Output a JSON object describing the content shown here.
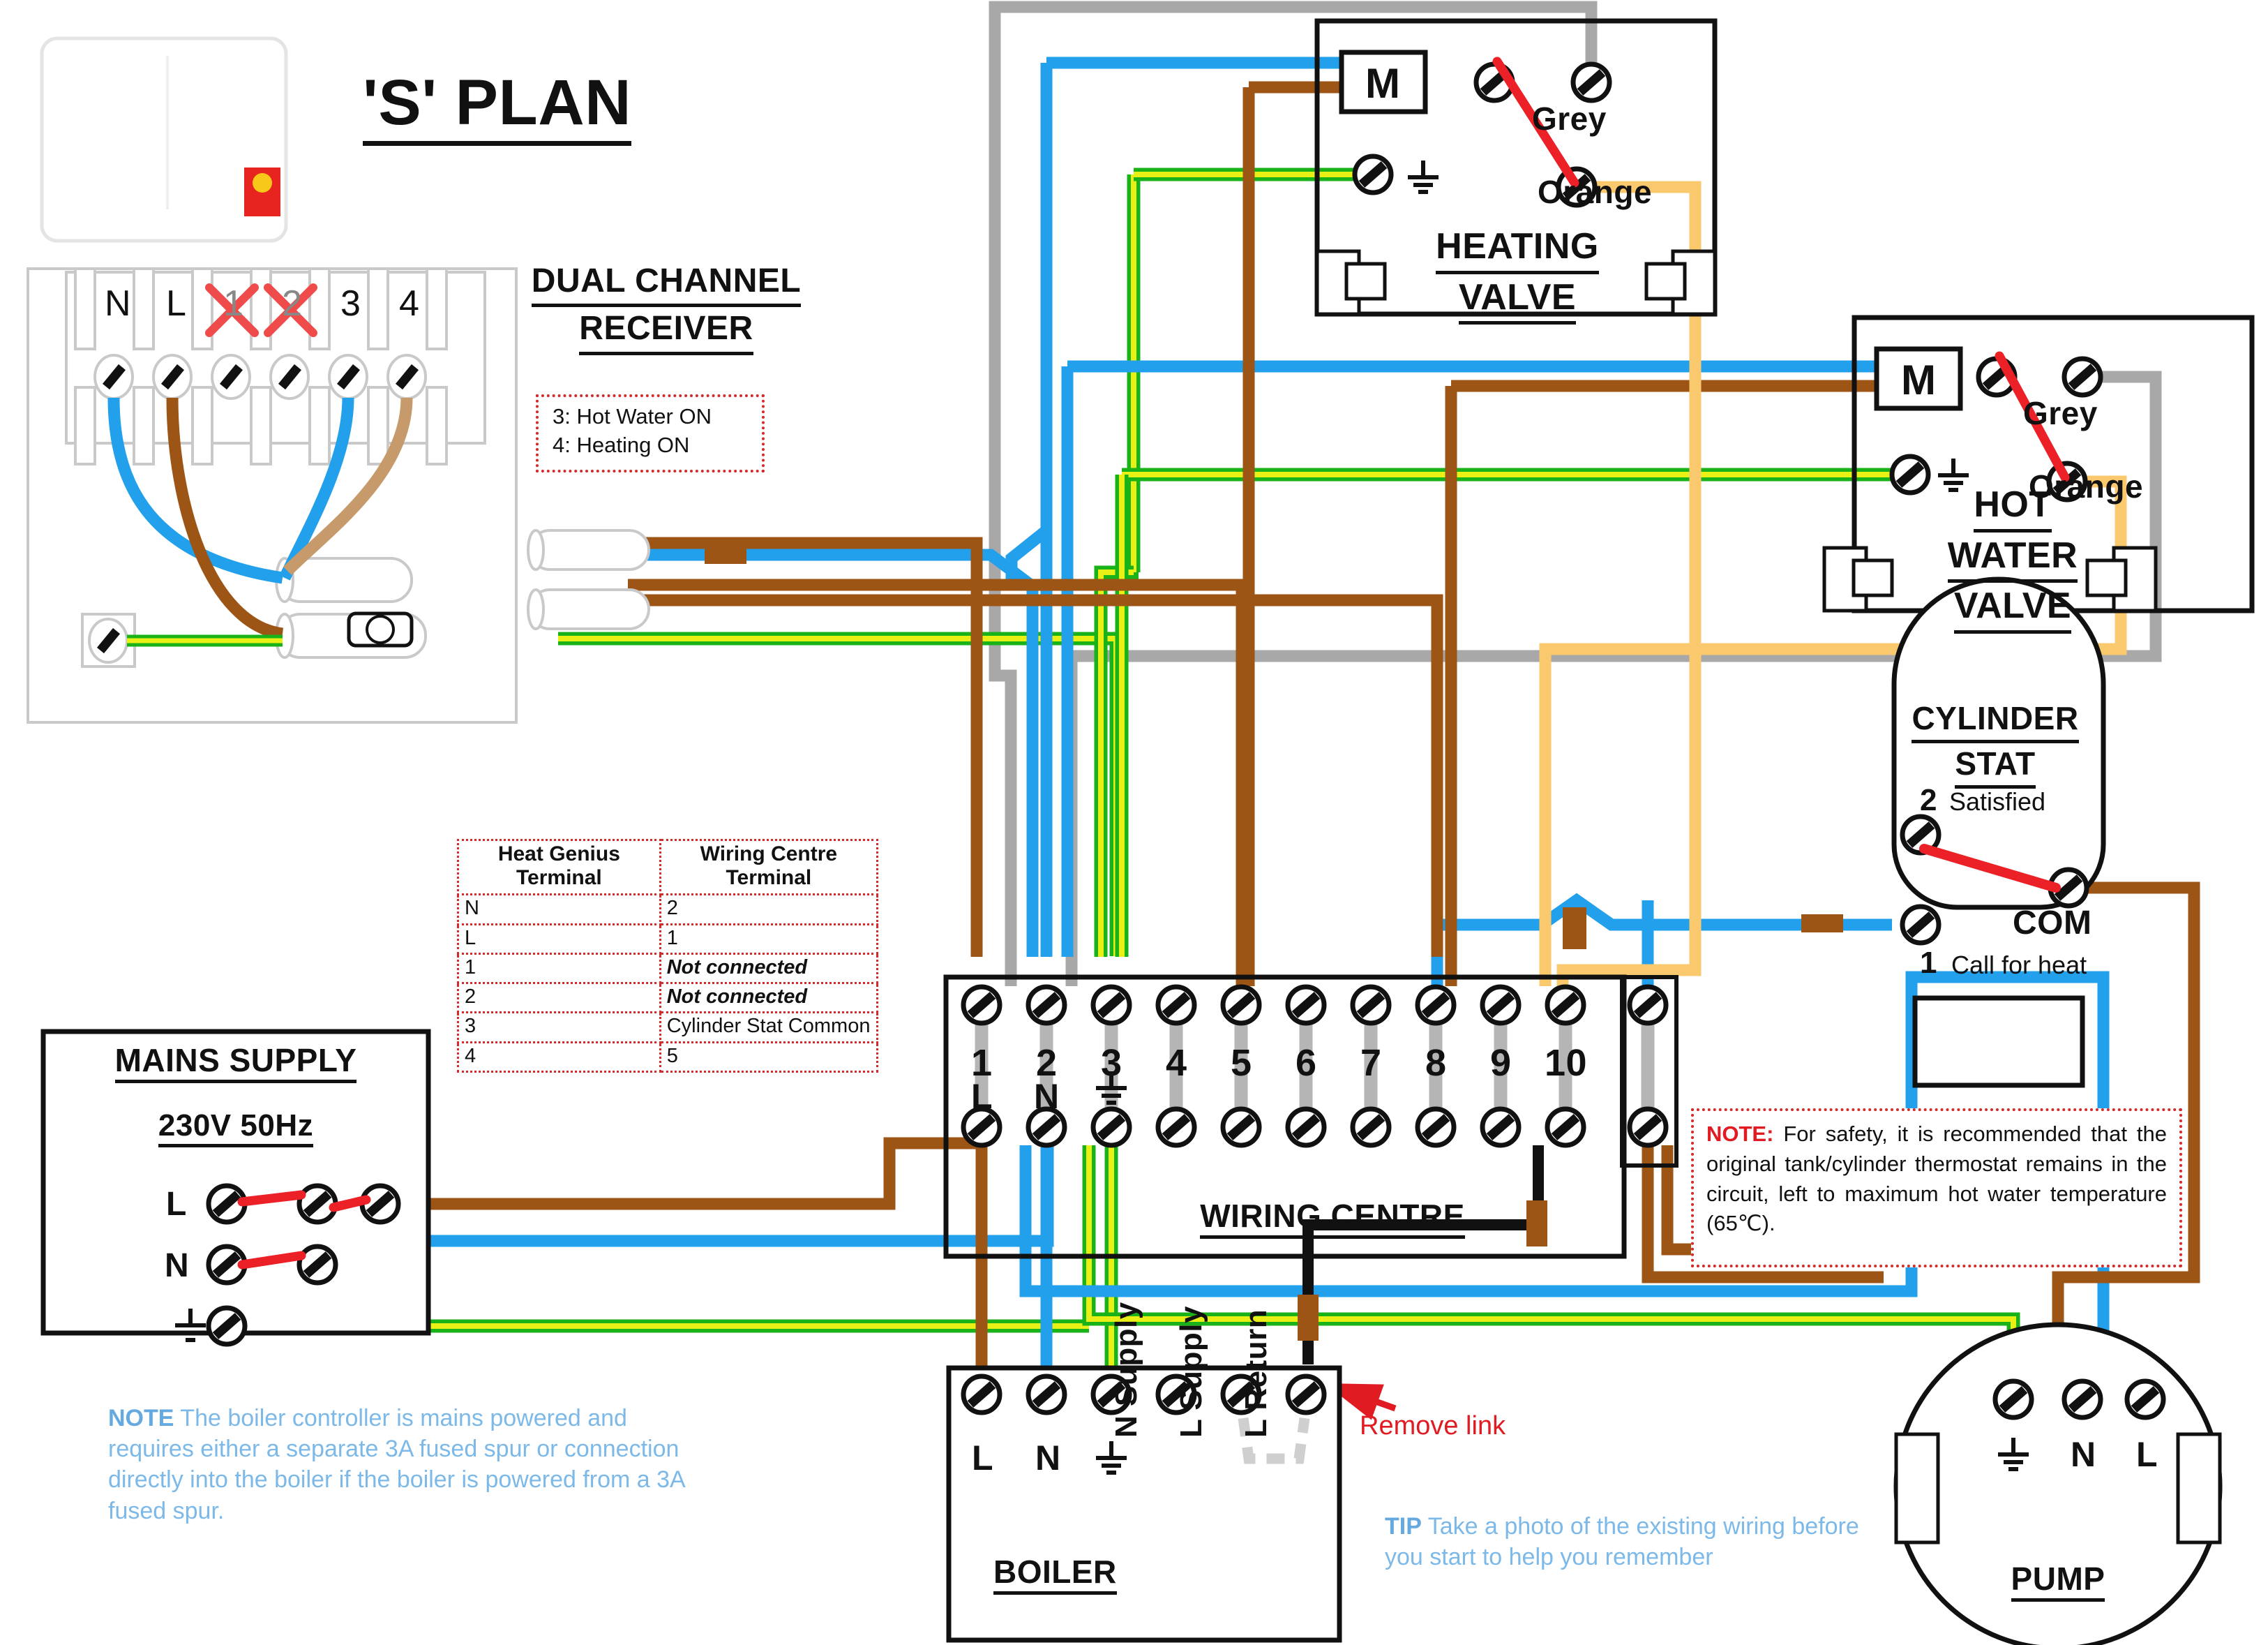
{
  "title": "'S' PLAN",
  "receiver": {
    "heading_line1": "DUAL CHANNEL",
    "heading_line2": "RECEIVER",
    "terminals": [
      "N",
      "L",
      "1",
      "2",
      "3",
      "4"
    ],
    "crossed_terminals": [
      "1",
      "2"
    ],
    "legend": [
      "3: Hot Water ON",
      "4: Heating ON"
    ]
  },
  "mapping_table": {
    "headers": [
      "Heat Genius Terminal",
      "Wiring Centre Terminal"
    ],
    "rows": [
      {
        "genius": "N",
        "centre": "2",
        "italic": false
      },
      {
        "genius": "L",
        "centre": "1",
        "italic": false
      },
      {
        "genius": "1",
        "centre": "Not connected",
        "italic": true
      },
      {
        "genius": "2",
        "centre": "Not connected",
        "italic": true
      },
      {
        "genius": "3",
        "centre": "Cylinder Stat Common",
        "italic": false
      },
      {
        "genius": "4",
        "centre": "5",
        "italic": false
      }
    ]
  },
  "mains": {
    "title": "MAINS SUPPLY",
    "rating": "230V 50Hz",
    "terminals": [
      "L",
      "N",
      "earth"
    ]
  },
  "heating_valve": {
    "title_line1": "HEATING",
    "title_line2": "VALVE",
    "motor": "M",
    "earth_symbol": "earth",
    "wire_labels": [
      "Grey",
      "Orange"
    ]
  },
  "hot_water_valve": {
    "title_line1": "HOT",
    "title_line2": "WATER",
    "title_line3": "VALVE",
    "motor": "M",
    "earth_symbol": "earth",
    "wire_labels": [
      "Grey",
      "Orange"
    ]
  },
  "cylinder_stat": {
    "title_line1": "CYLINDER",
    "title_line2": "STAT",
    "terminal_2_num": "2",
    "terminal_2_label": "Satisfied",
    "terminal_1_num": "1",
    "terminal_1_label": "Call for heat",
    "common_label": "COM"
  },
  "wiring_centre": {
    "title": "WIRING CENTRE",
    "terminal_numbers": [
      "1",
      "2",
      "3",
      "4",
      "5",
      "6",
      "7",
      "8",
      "9",
      "10"
    ],
    "terminal_roles": [
      "L",
      "N",
      "earth",
      "",
      "",
      "",
      "",
      "",
      "",
      ""
    ]
  },
  "boiler": {
    "title": "BOILER",
    "terminals": [
      "L",
      "N",
      "earth",
      "N Supply",
      "L Supply",
      "L Return"
    ],
    "link_annotation": "Remove link"
  },
  "pump": {
    "title": "PUMP",
    "terminals": [
      "earth",
      "N",
      "L"
    ]
  },
  "notes": {
    "safety_label": "NOTE:",
    "safety_text": "For safety, it is recommended that the original tank/cylinder thermostat remains in the circuit, left to maximum hot water temperature (65℃).",
    "boiler_label": "NOTE",
    "boiler_text": "The boiler controller is mains powered and requires either a separate 3A fused spur or connection directly into the boiler if the boiler is powered from a 3A fused spur.",
    "tip_label": "TIP",
    "tip_text": "Take a photo of the existing wiring before you start to help you remember"
  },
  "colors": {
    "blue": "#22a0ec",
    "brown": "#9c5515",
    "green": "#19b219",
    "yellow": "#e8f016",
    "grey": "#a8a8a8",
    "orange": "#fbc96d",
    "red": "#ec2027",
    "black": "#111111",
    "note_red": "#e11b22",
    "note_blue": "#7cb9e8"
  }
}
